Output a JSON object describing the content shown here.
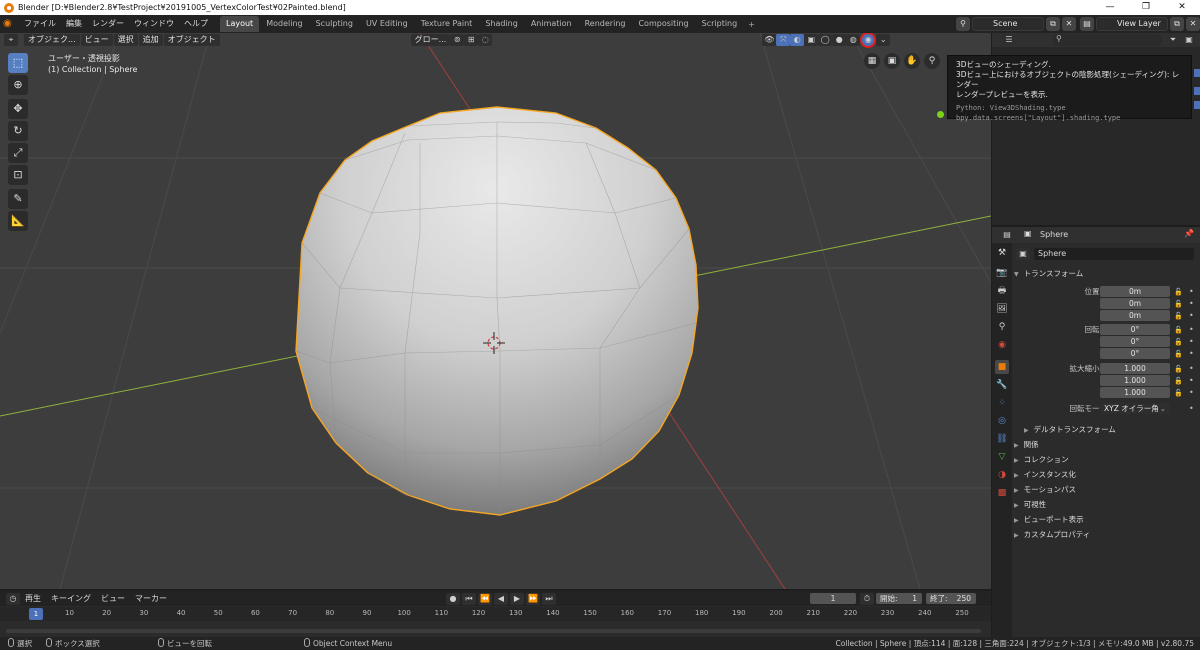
{
  "window": {
    "title": "Blender [D:¥Blender2.8¥TestProject¥20191005_VertexColorTest¥02Painted.blend]",
    "controls": [
      "—",
      "❐",
      "✕"
    ]
  },
  "menu": [
    "ファイル",
    "編集",
    "レンダー",
    "ウィンドウ",
    "ヘルプ"
  ],
  "workspaces": [
    "Layout",
    "Modeling",
    "Sculpting",
    "UV Editing",
    "Texture Paint",
    "Shading",
    "Animation",
    "Rendering",
    "Compositing",
    "Scripting"
  ],
  "workspace_add": "+",
  "scene": {
    "name": "Scene",
    "view_layer": "View Layer"
  },
  "viewport": {
    "mode": "オブジェク...",
    "menu": [
      "ビュー",
      "選択",
      "追加",
      "オブジェクト"
    ],
    "transform_orientation": "グロー...",
    "view_name": "ユーザー・透視投影",
    "collection_info": "(1) Collection | Sphere"
  },
  "tooltip": {
    "title": "3Dビューのシェーディング.",
    "line1": "3Dビュー上におけるオブジェクトの陰影処理(シェーディング): レンダー",
    "line2": "レンダープレビューを表示.",
    "python1": "Python: View3DShading.type",
    "python2": "bpy.data.screens[\"Layout\"].shading.type"
  },
  "properties": {
    "object_name": "Sphere",
    "object_data_name": "Sphere",
    "transform_panel": "トランスフォーム",
    "fields": [
      {
        "label": "位置 X",
        "value": "0m"
      },
      {
        "label": "Y",
        "value": "0m"
      },
      {
        "label": "Z",
        "value": "0m"
      },
      {
        "label": "回転 X",
        "value": "0°"
      },
      {
        "label": "Y",
        "value": "0°"
      },
      {
        "label": "Z",
        "value": "0°"
      },
      {
        "label": "拡大縮小 X",
        "value": "1.000"
      },
      {
        "label": "Y",
        "value": "1.000"
      },
      {
        "label": "Z",
        "value": "1.000"
      }
    ],
    "rotation_mode_label": "回転モード",
    "rotation_mode": "XYZ オイラー角",
    "delta_transform": "デルタトランスフォーム",
    "panels": [
      "関係",
      "コレクション",
      "インスタンス化",
      "モーションパス",
      "可視性",
      "ビューポート表示",
      "カスタムプロパティ"
    ]
  },
  "timeline": {
    "menu": [
      "再生",
      "キーイング",
      "ビュー",
      "マーカー"
    ],
    "current_frame": "1",
    "start_label": "開始:",
    "start": "1",
    "end_label": "終了:",
    "end": "250",
    "ticks": [
      "1",
      "10",
      "20",
      "30",
      "40",
      "50",
      "60",
      "70",
      "80",
      "90",
      "100",
      "110",
      "120",
      "130",
      "140",
      "150",
      "160",
      "170",
      "180",
      "190",
      "200",
      "210",
      "220",
      "230",
      "240",
      "250"
    ]
  },
  "statusbar": {
    "select": "選択",
    "box_select": "ボックス選択",
    "rotate_view": "ビューを回転",
    "context_menu": "Object Context Menu",
    "stats": "Collection | Sphere | 頂点:114 | 面:128 | 三角面:224 | オブジェクト:1/3 | メモリ:49.0 MB | v2.80.75"
  },
  "colors": {
    "selection_outline": "#f5a623",
    "x_axis": "#c0504d",
    "y_axis": "#8fb33a",
    "accent": "#4b72b8",
    "highlight_circle": "#e0201e"
  }
}
